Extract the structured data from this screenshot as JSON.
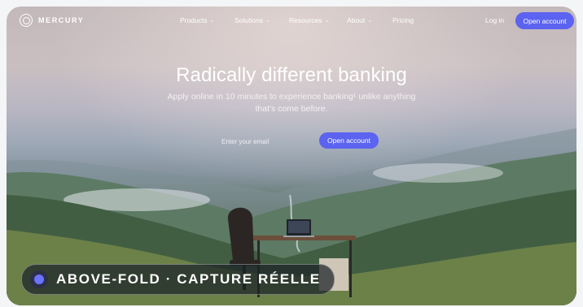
{
  "brand": {
    "name": "MERCURY",
    "logo_icon": "mercury-logo-icon"
  },
  "nav": {
    "items": [
      {
        "label": "Products",
        "has_dropdown": true
      },
      {
        "label": "Solutions",
        "has_dropdown": true
      },
      {
        "label": "Resources",
        "has_dropdown": true
      },
      {
        "label": "About",
        "has_dropdown": true
      },
      {
        "label": "Pricing",
        "has_dropdown": false
      }
    ],
    "login": "Log in",
    "cta": "Open account"
  },
  "hero": {
    "title": "Radically different banking",
    "subtitle": "Apply online in 10 minutes to experience banking¹ unlike anything that's come before.",
    "email_placeholder": "Enter your email",
    "cta": "Open account"
  },
  "badge": {
    "text": "ABOVE-FOLD · CAPTURE RÉELLE"
  },
  "colors": {
    "accent": "#5b63f0"
  }
}
